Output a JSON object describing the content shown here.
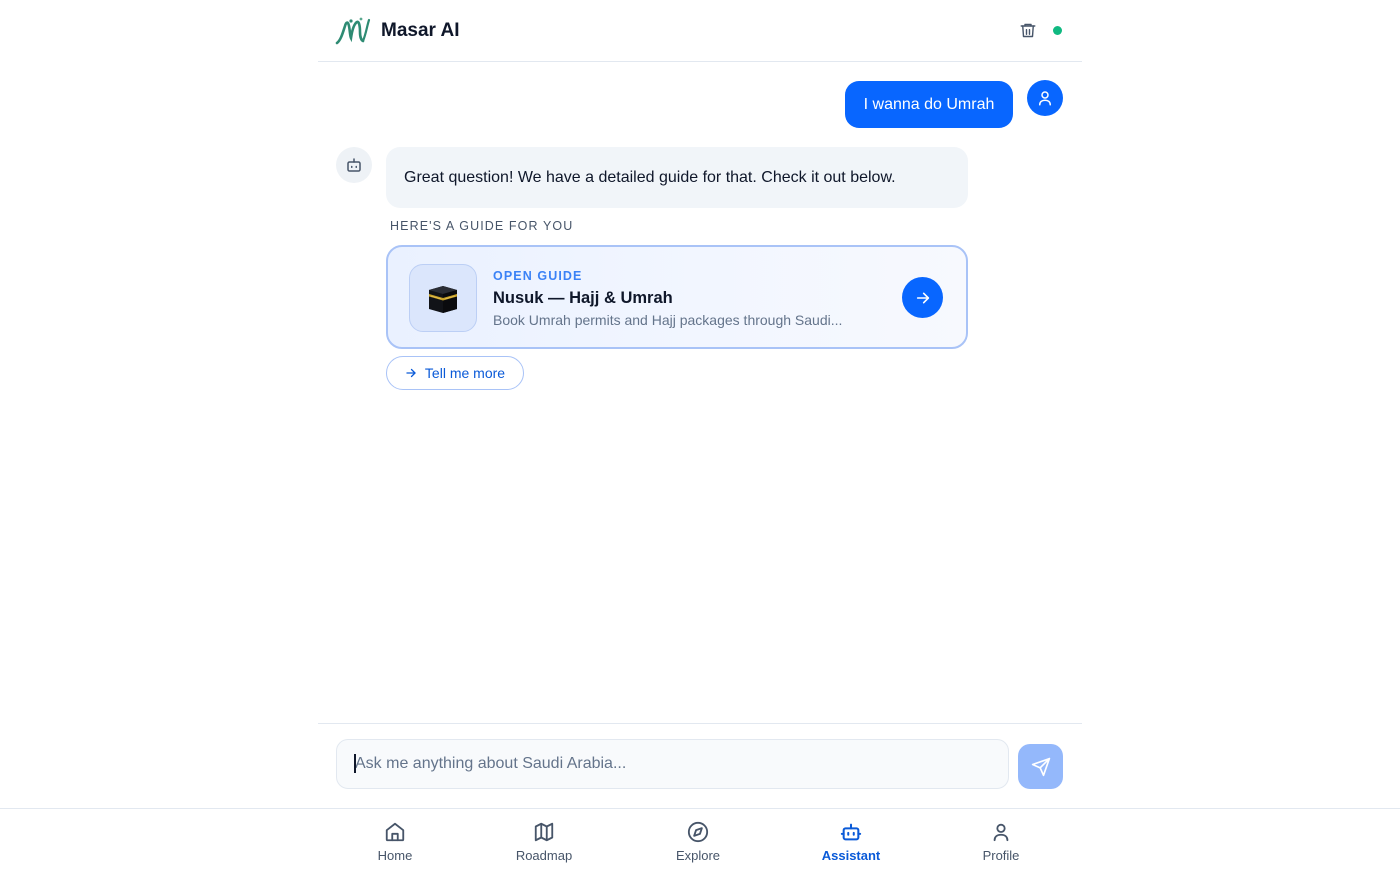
{
  "header": {
    "title": "Masar AI",
    "logo_icon": "masar-logo",
    "trash_icon": "trash-icon",
    "status_color": "#10b981"
  },
  "chat": {
    "user_message": "I wanna do Umrah",
    "bot_message": "Great question! We have a detailed guide for that. Check it out below.",
    "guide_heading": "HERE'S A GUIDE FOR YOU",
    "guide_card": {
      "kicker": "OPEN GUIDE",
      "title": "Nusuk — Hajj & Umrah",
      "description": "Book Umrah permits and Hajj packages through Saudi...",
      "thumbnail_icon": "kaaba-icon",
      "arrow_icon": "arrow-right-icon"
    },
    "suggestion_chip": "Tell me more"
  },
  "composer": {
    "placeholder": "Ask me anything about Saudi Arabia...",
    "value": "",
    "send_icon": "send-icon"
  },
  "nav": {
    "items": [
      {
        "label": "Home",
        "icon": "home-icon",
        "active": false
      },
      {
        "label": "Roadmap",
        "icon": "map-icon",
        "active": false
      },
      {
        "label": "Explore",
        "icon": "compass-icon",
        "active": false
      },
      {
        "label": "Assistant",
        "icon": "bot-icon",
        "active": true
      },
      {
        "label": "Profile",
        "icon": "user-icon",
        "active": false
      }
    ]
  },
  "colors": {
    "accent": "#0866ff",
    "active_nav": "#0a5ad8",
    "send_disabled": "#94b8fb"
  }
}
